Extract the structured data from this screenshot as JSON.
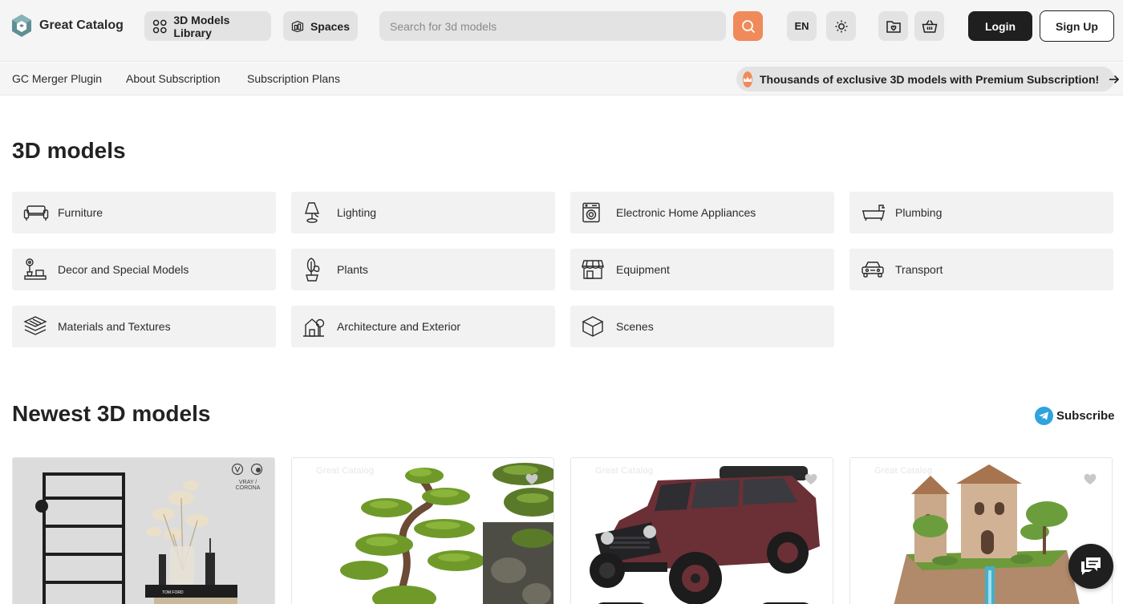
{
  "header": {
    "logo_text": "Great Catalog",
    "models_library_label": "3D Models Library",
    "spaces_label": "Spaces",
    "search_placeholder": "Search for 3d models",
    "language": "EN",
    "login_label": "Login",
    "signup_label": "Sign Up"
  },
  "subnav": {
    "links": [
      "GC Merger Plugin",
      "About Subscription",
      "Subscription Plans"
    ],
    "promo_text": "Thousands of exclusive 3D models with Premium Subscription!"
  },
  "sections": {
    "models_title": "3D models",
    "newest_title": "Newest 3D models",
    "subscribe_label": "Subscribe"
  },
  "categories": [
    {
      "label": "Furniture",
      "icon": "sofa-icon"
    },
    {
      "label": "Lighting",
      "icon": "lamp-icon"
    },
    {
      "label": "Electronic Home Appliances",
      "icon": "washing-machine-icon"
    },
    {
      "label": "Plumbing",
      "icon": "bathtub-icon"
    },
    {
      "label": "Decor and Special Models",
      "icon": "decor-icon"
    },
    {
      "label": "Plants",
      "icon": "plant-icon"
    },
    {
      "label": "Equipment",
      "icon": "store-icon"
    },
    {
      "label": "Transport",
      "icon": "car-icon"
    },
    {
      "label": "Materials and Textures",
      "icon": "layers-icon"
    },
    {
      "label": "Architecture and Exterior",
      "icon": "house-tree-icon"
    },
    {
      "label": "Scenes",
      "icon": "box-icon"
    }
  ],
  "cards": [
    {
      "name": "Towel rail with dried flowers decor",
      "badge": "VRAY / CORONA"
    },
    {
      "name": "Bonsai pine tree"
    },
    {
      "name": "Red off-road jeep"
    },
    {
      "name": "Castle on a cliff with waterfall"
    }
  ],
  "watermark": "Great Catalog",
  "colors": {
    "accent": "#f08a5a",
    "dark": "#1f1f1f",
    "header_bg": "#f5f5f5",
    "pill_bg": "#e3e3e3",
    "telegram": "#2ea3dd"
  }
}
